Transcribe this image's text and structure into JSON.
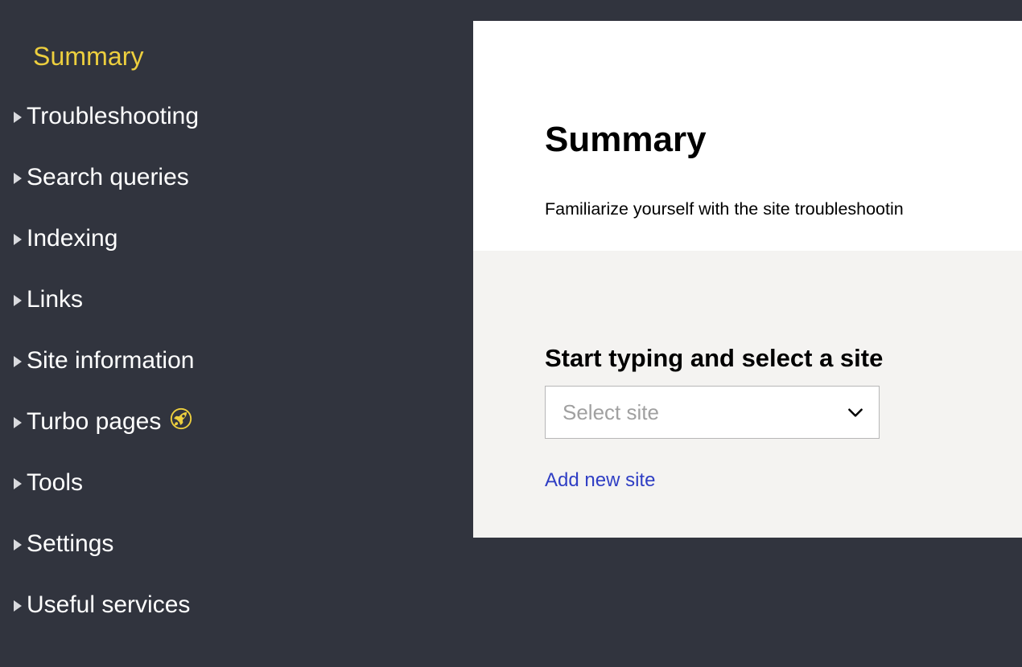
{
  "colors": {
    "sidebar_bg": "#31343e",
    "accent_yellow": "#edcf3e",
    "panel_white": "#ffffff",
    "panel_gray": "#f4f3f1",
    "link_blue": "#2f3ec4",
    "placeholder_gray": "#a0a0a0",
    "border_gray": "#b7b7b7"
  },
  "sidebar": {
    "current_section": "Summary",
    "items": [
      {
        "label": "Troubleshooting",
        "caret": "triangle-right-icon",
        "badge": null
      },
      {
        "label": "Search queries",
        "caret": "triangle-right-icon",
        "badge": null
      },
      {
        "label": "Indexing",
        "caret": "triangle-right-icon",
        "badge": null
      },
      {
        "label": "Links",
        "caret": "triangle-right-icon",
        "badge": null
      },
      {
        "label": "Site information",
        "caret": "triangle-right-icon",
        "badge": null
      },
      {
        "label": "Turbo pages",
        "caret": "triangle-right-icon",
        "badge": "rocket-icon"
      },
      {
        "label": "Tools",
        "caret": "triangle-right-icon",
        "badge": null
      },
      {
        "label": "Settings",
        "caret": "triangle-right-icon",
        "badge": null
      },
      {
        "label": "Useful services",
        "caret": "triangle-right-icon",
        "badge": null
      }
    ]
  },
  "main": {
    "title": "Summary",
    "description": "Familiarize yourself with the site troubleshootin",
    "site_picker": {
      "heading": "Start typing and select a site",
      "select_value": "Select site",
      "select_placeholder": "Select site",
      "chevron": "chevron-down-icon",
      "add_link": "Add new site"
    }
  }
}
